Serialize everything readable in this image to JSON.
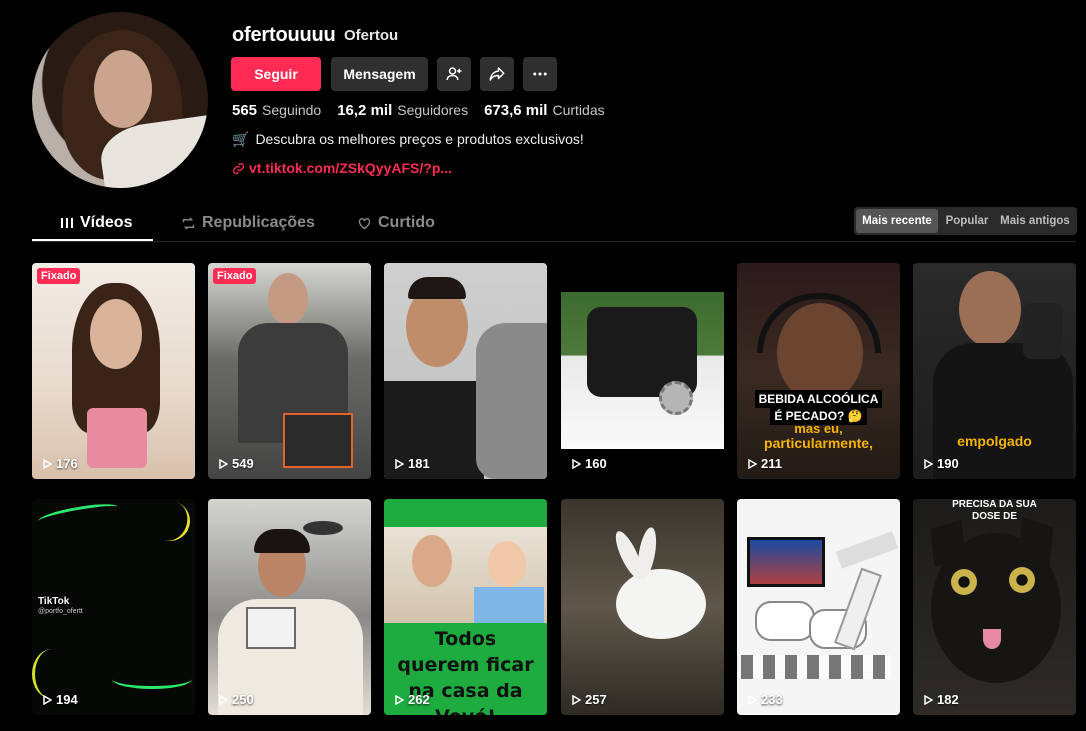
{
  "profile": {
    "username": "ofertouuuu",
    "nickname": "Ofertou",
    "follow_label": "Seguir",
    "message_label": "Mensagem",
    "bio": "Descubra os melhores preços e produtos exclusivos!",
    "bio_icon": "🛒",
    "link": "vt.tiktok.com/ZSkQyyAFS/?p..."
  },
  "stats": {
    "following_num": "565",
    "following_lbl": "Seguindo",
    "followers_num": "16,2 mil",
    "followers_lbl": "Seguidores",
    "likes_num": "673,6 mil",
    "likes_lbl": "Curtidas"
  },
  "tabs": {
    "videos": "Vídeos",
    "reposts": "Republicações",
    "liked": "Curtido"
  },
  "sort": {
    "recent": "Mais recente",
    "popular": "Popular",
    "oldest": "Mais antigos"
  },
  "pinned_label": "Fixado",
  "videos": [
    {
      "views": "176",
      "pinned": true
    },
    {
      "views": "549",
      "pinned": true
    },
    {
      "views": "181"
    },
    {
      "views": "160"
    },
    {
      "views": "211",
      "caption1": "BEBIDA ALCOÓLICA",
      "caption2": "É PECADO? 🤔",
      "caption3": "mas eu,",
      "caption4": "particularmente,"
    },
    {
      "views": "190",
      "caption1": "empolgado"
    },
    {
      "views": "194",
      "caption1": "TikTok",
      "caption2": "@portfo_ofertt"
    },
    {
      "views": "250"
    },
    {
      "views": "262",
      "caption1": "Todos querem ficar na casa da Vovó!"
    },
    {
      "views": "257"
    },
    {
      "views": "233"
    },
    {
      "views": "182",
      "caption1": "PRECISA DA SUA",
      "caption2": "DOSE DE"
    }
  ],
  "colors": {
    "accent": "#fe2c55",
    "button_dark": "#2f2f2f",
    "background": "#000000"
  }
}
